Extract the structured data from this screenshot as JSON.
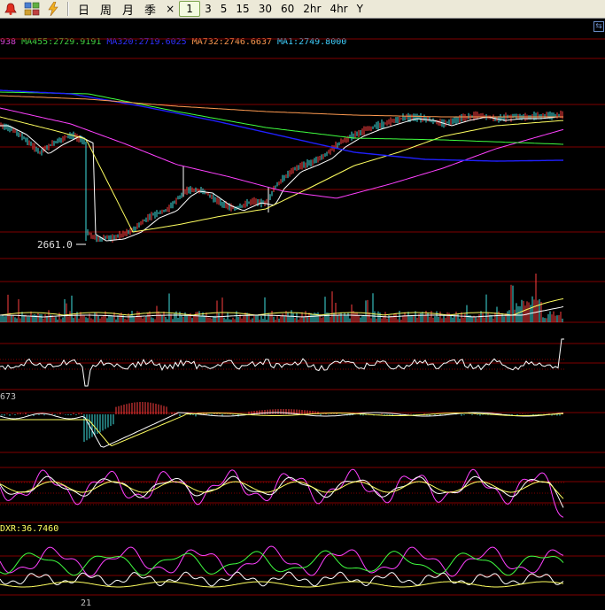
{
  "toolbar": {
    "icons": [
      "alarm-icon",
      "multi-chart-icon",
      "lightning-icon"
    ],
    "period_buttons": [
      {
        "label": "日",
        "cjk": true
      },
      {
        "label": "周",
        "cjk": true
      },
      {
        "label": "月",
        "cjk": true
      },
      {
        "label": "季",
        "cjk": true
      },
      {
        "label": "×",
        "cjk": false
      },
      {
        "label": "1",
        "cjk": false,
        "active": true
      },
      {
        "label": "3",
        "cjk": false
      },
      {
        "label": "5",
        "cjk": false
      },
      {
        "label": "15",
        "cjk": false
      },
      {
        "label": "30",
        "cjk": false
      },
      {
        "label": "60",
        "cjk": false
      },
      {
        "label": "2hr",
        "cjk": false
      },
      {
        "label": "4hr",
        "cjk": false
      },
      {
        "label": "Y",
        "cjk": false
      }
    ]
  },
  "ma_legend": [
    {
      "text": "938",
      "color": "#d040d0"
    },
    {
      "text": "MA455:2729.9191",
      "color": "#40d040"
    },
    {
      "text": "MA320:2719.6025",
      "color": "#3030ff"
    },
    {
      "text": "MA732:2746.6637",
      "color": "#ff9a50"
    },
    {
      "text": "MA1:2749.8000",
      "color": "#40d0ff"
    }
  ],
  "price_min_label": "2661.0",
  "panel3_label": "673",
  "panel5_label": "DXR:36.7460",
  "date_label": "21",
  "colors": {
    "background": "#000000",
    "grid": "#800000",
    "up_candle": "#ff4040",
    "down_candle": "#40e0e0",
    "white": "#ffffff",
    "yellow": "#ffff60",
    "magenta": "#ff40ff",
    "green": "#40ff40",
    "blue": "#2020ff",
    "orange": "#ff9a50",
    "dark_magenta": "#d040d0"
  }
}
